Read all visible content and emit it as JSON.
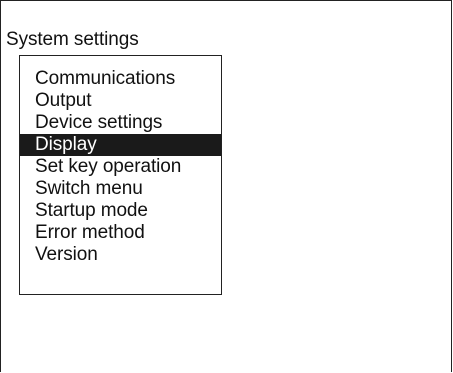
{
  "screen": {
    "title": "System settings"
  },
  "menu": {
    "items": [
      {
        "label": "Communications",
        "selected": false
      },
      {
        "label": "Output",
        "selected": false
      },
      {
        "label": "Device settings",
        "selected": false
      },
      {
        "label": "Display",
        "selected": true
      },
      {
        "label": "Set key operation",
        "selected": false
      },
      {
        "label": "Switch menu",
        "selected": false
      },
      {
        "label": "Startup mode",
        "selected": false
      },
      {
        "label": "Error method",
        "selected": false
      },
      {
        "label": "Version",
        "selected": false
      }
    ]
  },
  "colors": {
    "selection_background": "#1a1a1a",
    "selection_text": "#ffffff",
    "text": "#111111",
    "background": "#ffffff"
  }
}
